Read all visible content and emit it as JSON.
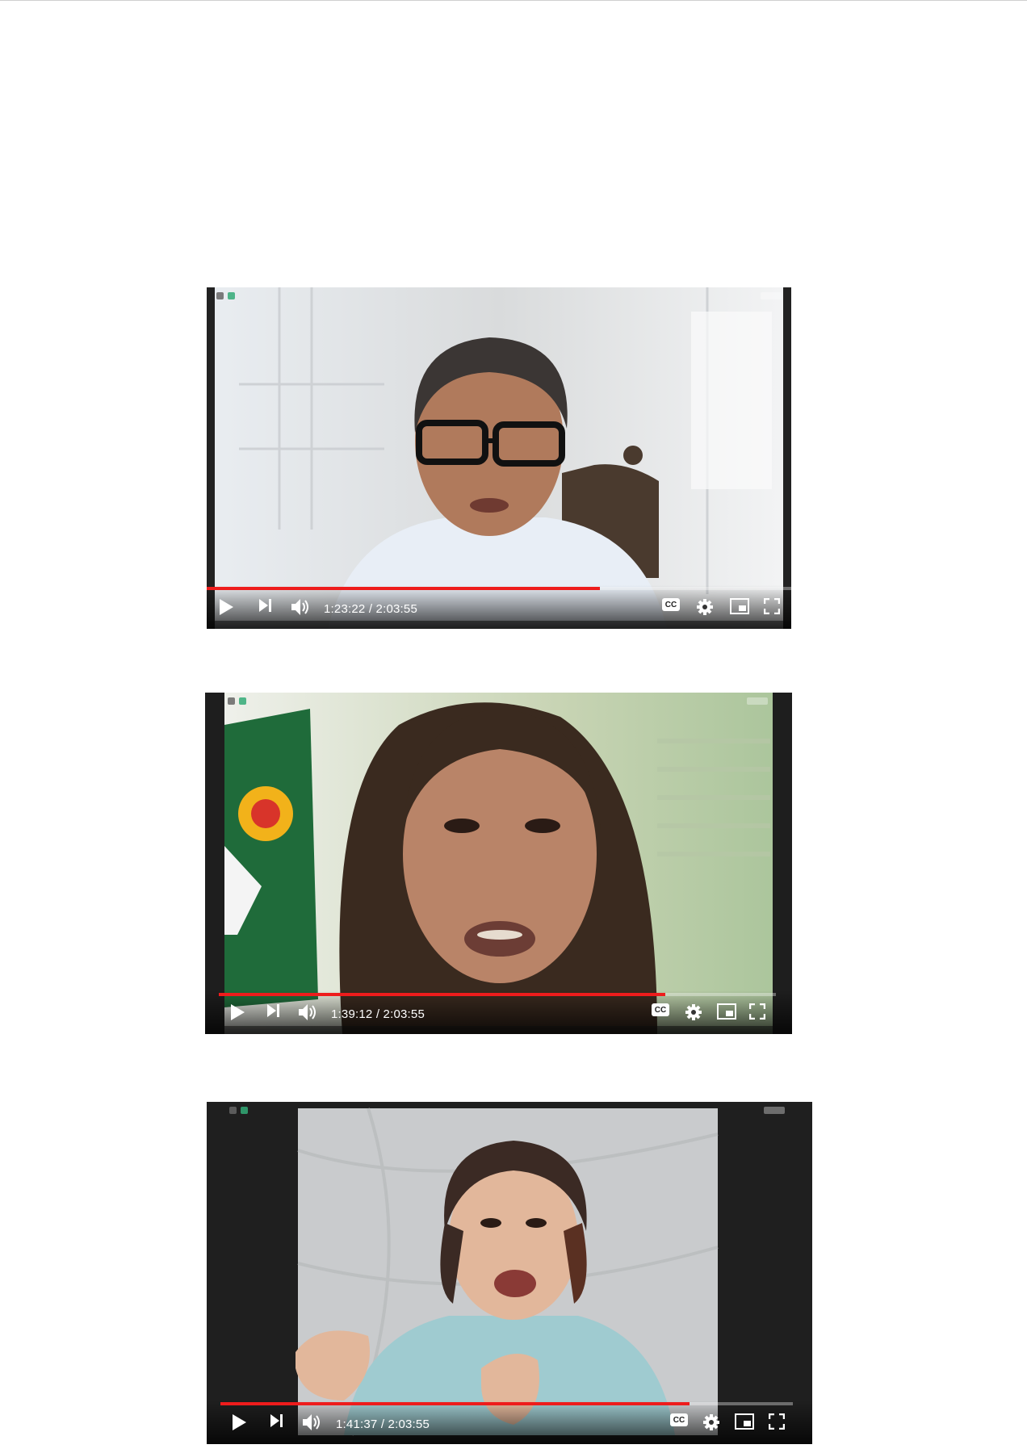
{
  "players": [
    {
      "time_text": "1:23:22 / 2:03:55",
      "progress": 0.673
    },
    {
      "time_text": "1:39:12 / 2:03:55",
      "progress": 0.801
    },
    {
      "time_text": "1:41:37 / 2:03:55",
      "progress": 0.82
    }
  ],
  "controls": {
    "cc_label": "CC",
    "icons": [
      "play-icon",
      "next-icon",
      "volume-icon",
      "captions-icon",
      "settings-icon",
      "miniplayer-icon",
      "fullscreen-icon"
    ]
  },
  "colors": {
    "progress": "#ee1c1c",
    "control_fg": "#ffffff"
  }
}
